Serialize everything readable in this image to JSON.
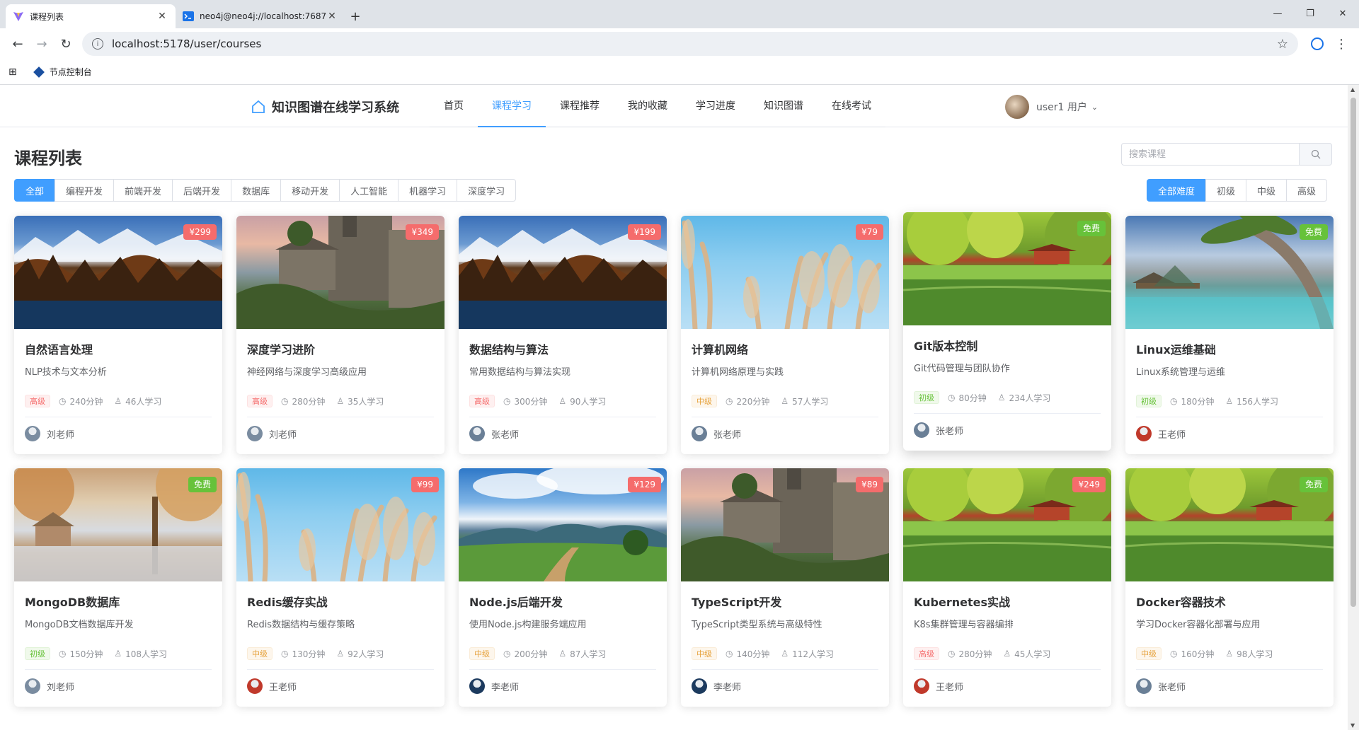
{
  "browser": {
    "tabs": [
      {
        "title": "课程列表",
        "active": true
      },
      {
        "title": "neo4j@neo4j://localhost:7687",
        "active": false
      }
    ],
    "url": "localhost:5178/user/courses",
    "bookmark": "节点控制台"
  },
  "header": {
    "logo": "知识图谱在线学习系统",
    "nav": [
      "首页",
      "课程学习",
      "课程推荐",
      "我的收藏",
      "学习进度",
      "知识图谱",
      "在线考试"
    ],
    "active_nav": "课程学习",
    "user": "user1 用户"
  },
  "page": {
    "title": "课程列表",
    "search_placeholder": "搜索课程",
    "categories": [
      "全部",
      "编程开发",
      "前端开发",
      "后端开发",
      "数据库",
      "移动开发",
      "人工智能",
      "机器学习",
      "深度学习"
    ],
    "active_category": "全部",
    "levels": [
      "全部难度",
      "初级",
      "中级",
      "高级"
    ],
    "active_level": "全部难度"
  },
  "courses": [
    {
      "title": "自然语言处理",
      "desc": "NLP技术与文本分析",
      "price": "¥299",
      "free": false,
      "level": "高级",
      "duration": "240分钟",
      "learners": "46人学习",
      "teacher": "刘老师",
      "scene": "mountain",
      "teacher_color": "#7a8ca0"
    },
    {
      "title": "深度学习进阶",
      "desc": "神经网络与深度学习高级应用",
      "price": "¥349",
      "free": false,
      "level": "高级",
      "duration": "280分钟",
      "learners": "35人学习",
      "teacher": "刘老师",
      "scene": "castle",
      "teacher_color": "#7a8ca0"
    },
    {
      "title": "数据结构与算法",
      "desc": "常用数据结构与算法实现",
      "price": "¥199",
      "free": false,
      "level": "高级",
      "duration": "300分钟",
      "learners": "90人学习",
      "teacher": "张老师",
      "scene": "mountain",
      "teacher_color": "#6a7f96"
    },
    {
      "title": "计算机网络",
      "desc": "计算机网络原理与实践",
      "price": "¥79",
      "free": false,
      "level": "中级",
      "duration": "220分钟",
      "learners": "57人学习",
      "teacher": "张老师",
      "scene": "grass",
      "teacher_color": "#6a7f96"
    },
    {
      "title": "Git版本控制",
      "desc": "Git代码管理与团队协作",
      "price": "免费",
      "free": true,
      "level": "初级",
      "duration": "80分钟",
      "learners": "234人学习",
      "teacher": "张老师",
      "scene": "pavilion",
      "teacher_color": "#6a7f96",
      "lift": true
    },
    {
      "title": "Linux运维基础",
      "desc": "Linux系统管理与运维",
      "price": "免费",
      "free": true,
      "level": "初级",
      "duration": "180分钟",
      "learners": "156人学习",
      "teacher": "王老师",
      "scene": "beach",
      "teacher_color": "#c0392b"
    },
    {
      "title": "MongoDB数据库",
      "desc": "MongoDB文档数据库开发",
      "price": "免费",
      "free": true,
      "level": "初级",
      "duration": "150分钟",
      "learners": "108人学习",
      "teacher": "刘老师",
      "scene": "autumn",
      "teacher_color": "#7a8ca0"
    },
    {
      "title": "Redis缓存实战",
      "desc": "Redis数据结构与缓存策略",
      "price": "¥99",
      "free": false,
      "level": "中级",
      "duration": "130分钟",
      "learners": "92人学习",
      "teacher": "王老师",
      "scene": "grass",
      "teacher_color": "#c0392b"
    },
    {
      "title": "Node.js后端开发",
      "desc": "使用Node.js构建服务端应用",
      "price": "¥129",
      "free": false,
      "level": "中级",
      "duration": "200分钟",
      "learners": "87人学习",
      "teacher": "李老师",
      "scene": "valley",
      "teacher_color": "#1c3a5e"
    },
    {
      "title": "TypeScript开发",
      "desc": "TypeScript类型系统与高级特性",
      "price": "¥89",
      "free": false,
      "level": "中级",
      "duration": "140分钟",
      "learners": "112人学习",
      "teacher": "李老师",
      "scene": "castle",
      "teacher_color": "#1c3a5e"
    },
    {
      "title": "Kubernetes实战",
      "desc": "K8s集群管理与容器编排",
      "price": "¥249",
      "free": false,
      "level": "高级",
      "duration": "280分钟",
      "learners": "45人学习",
      "teacher": "王老师",
      "scene": "pavilion",
      "teacher_color": "#c0392b"
    },
    {
      "title": "Docker容器技术",
      "desc": "学习Docker容器化部署与应用",
      "price": "免费",
      "free": true,
      "level": "中级",
      "duration": "160分钟",
      "learners": "98人学习",
      "teacher": "张老师",
      "scene": "pavilion",
      "teacher_color": "#6a7f96"
    }
  ],
  "colors": {
    "primary": "#409eff",
    "paid": "#f56c6c",
    "free": "#67c23a"
  }
}
